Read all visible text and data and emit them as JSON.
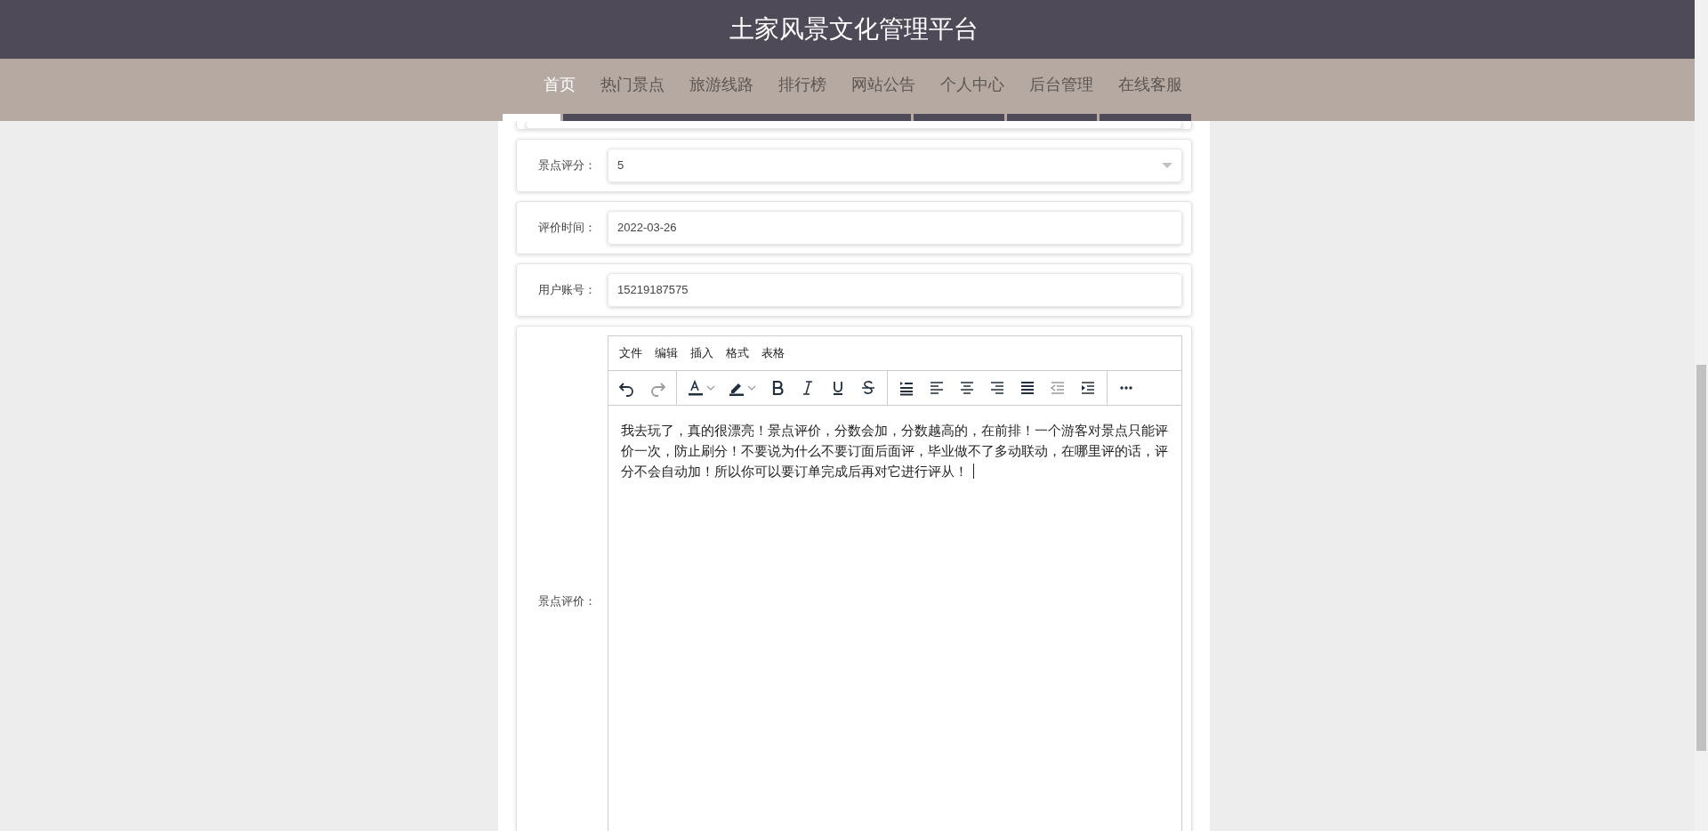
{
  "header": {
    "title": "土家风景文化管理平台"
  },
  "nav": [
    {
      "label": "首页",
      "selected": true
    },
    {
      "label": "热门景点",
      "selected": false
    },
    {
      "label": "旅游线路",
      "selected": false
    },
    {
      "label": "排行榜",
      "selected": false
    },
    {
      "label": "网站公告",
      "selected": false
    },
    {
      "label": "个人中心",
      "selected": false
    },
    {
      "label": "后台管理",
      "selected": false
    },
    {
      "label": "在线客服",
      "selected": false
    }
  ],
  "form": {
    "fields": [
      {
        "kind": "select",
        "label": "景点评分：",
        "value": "5"
      },
      {
        "kind": "text",
        "label": "评价时间：",
        "value": "2022-03-26"
      },
      {
        "kind": "text",
        "label": "用户账号：",
        "value": "15219187575"
      }
    ],
    "editor": {
      "label": "景点评价：",
      "menu": [
        "文件",
        "编辑",
        "插入",
        "格式",
        "表格"
      ],
      "toolbar": [
        [
          {
            "kind": "undo",
            "disabled": false
          },
          {
            "kind": "redo",
            "disabled": true
          }
        ],
        [
          {
            "kind": "text-color",
            "disabled": false
          },
          {
            "kind": "highlight",
            "disabled": false
          },
          {
            "kind": "bold",
            "disabled": false
          },
          {
            "kind": "italic",
            "disabled": false
          },
          {
            "kind": "underline",
            "disabled": false
          },
          {
            "kind": "strikethrough",
            "disabled": false
          }
        ],
        [
          {
            "kind": "line-height",
            "disabled": false
          },
          {
            "kind": "align-left",
            "disabled": false
          },
          {
            "kind": "align-center",
            "disabled": false
          },
          {
            "kind": "align-right",
            "disabled": false
          },
          {
            "kind": "justify",
            "disabled": false
          },
          {
            "kind": "outdent",
            "disabled": true
          },
          {
            "kind": "indent",
            "disabled": false
          }
        ],
        [
          {
            "kind": "more",
            "disabled": false
          }
        ]
      ],
      "content": "我去玩了，真的很漂亮！景点评价，分数会加，分数越高的，在前排！一个游客对景点只能评价一次，防止刷分！不要说为什么不要订面后面评，毕业做不了多动联动，在哪里评的话，评分不会自动加！所以你可以要订单完成后再对它进行评从！"
    }
  }
}
